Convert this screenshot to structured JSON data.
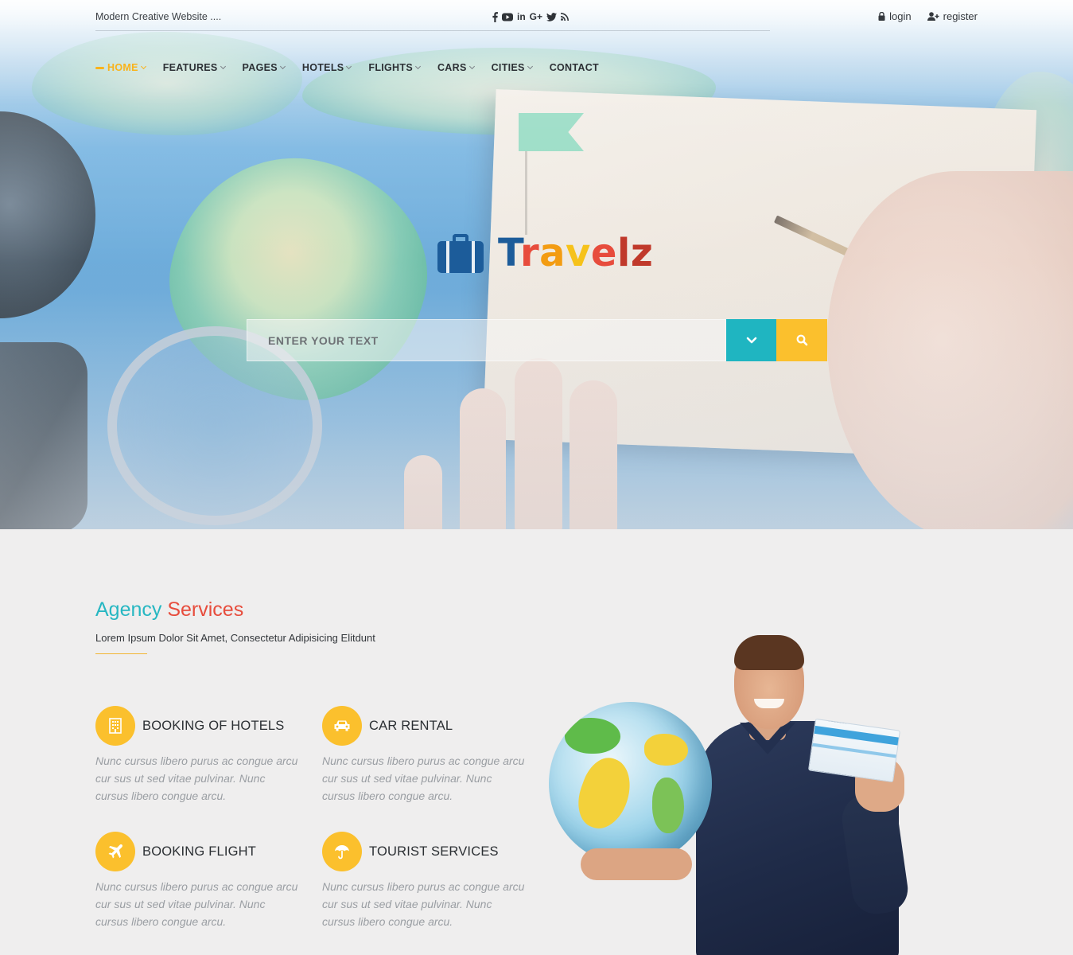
{
  "topbar": {
    "tagline": "Modern Creative Website ....",
    "social": [
      {
        "icon": "facebook-icon",
        "glyph": "f"
      },
      {
        "icon": "youtube-icon",
        "glyph": "▶"
      },
      {
        "icon": "linkedin-icon",
        "glyph": "in"
      },
      {
        "icon": "google-plus-icon",
        "glyph": "G+"
      },
      {
        "icon": "twitter-icon",
        "glyph": "🐦"
      },
      {
        "icon": "rss-icon",
        "glyph": "◔"
      }
    ],
    "login_label": "login",
    "register_label": "register"
  },
  "nav": {
    "items": [
      {
        "label": "HOME",
        "active": true,
        "has_dropdown": true
      },
      {
        "label": "FEATURES",
        "has_dropdown": true
      },
      {
        "label": "PAGES",
        "has_dropdown": true
      },
      {
        "label": "HOTELS",
        "has_dropdown": true
      },
      {
        "label": "FLIGHTS",
        "has_dropdown": true
      },
      {
        "label": "CARS",
        "has_dropdown": true
      },
      {
        "label": "CITIES",
        "has_dropdown": true
      },
      {
        "label": "CONTACT",
        "has_dropdown": false
      }
    ]
  },
  "logo": {
    "letters": [
      "T",
      "r",
      "a",
      "v",
      "e",
      "l",
      "z"
    ]
  },
  "search": {
    "placeholder": "ENTER YOUR TEXT"
  },
  "services": {
    "title_part1": "Agency",
    "title_part2": "Services",
    "subtitle": "Lorem Ipsum Dolor Sit Amet, Consectetur Adipisicing Elitdunt",
    "items": [
      {
        "title": "BOOKING OF HOTELS",
        "icon": "hotel-icon",
        "description": "Nunc cursus libero purus ac congue arcu cur sus ut sed vitae pulvinar. Nunc cursus libero congue arcu."
      },
      {
        "title": "CAR RENTAL",
        "icon": "car-icon",
        "description": "Nunc cursus libero purus ac congue arcu cur sus ut sed vitae pulvinar. Nunc cursus libero congue arcu."
      },
      {
        "title": "BOOKING FLIGHT",
        "icon": "plane-icon",
        "description": "Nunc cursus libero purus ac congue arcu cur sus ut sed vitae pulvinar. Nunc cursus libero congue arcu."
      },
      {
        "title": "TOURIST SERVICES",
        "icon": "umbrella-icon",
        "description": "Nunc cursus libero purus ac congue arcu cur sus ut sed vitae pulvinar. Nunc cursus libero congue arcu."
      }
    ]
  },
  "colors": {
    "accent_yellow": "#fbc02d",
    "accent_teal": "#1fb5c1",
    "brand_blue": "#1c5c9a",
    "title_red": "#e74c3c"
  }
}
